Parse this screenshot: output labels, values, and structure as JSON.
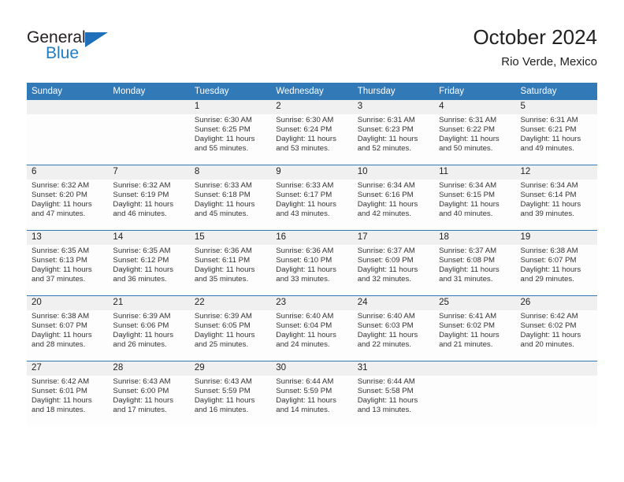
{
  "brand": {
    "name_part1": "General",
    "name_part2": "Blue",
    "accent_color": "#1f7dc4",
    "triangle_color": "#1f6fbb"
  },
  "header": {
    "title": "October 2024",
    "subtitle": "Rio Verde, Mexico"
  },
  "calendar": {
    "header_bg": "#3279b8",
    "header_text_color": "#ffffff",
    "daynum_bg": "#f0f0f0",
    "weekdays": [
      "Sunday",
      "Monday",
      "Tuesday",
      "Wednesday",
      "Thursday",
      "Friday",
      "Saturday"
    ],
    "weeks": [
      [
        {
          "day": "",
          "sunrise": "",
          "sunset": "",
          "daylight1": "",
          "daylight2": ""
        },
        {
          "day": "",
          "sunrise": "",
          "sunset": "",
          "daylight1": "",
          "daylight2": ""
        },
        {
          "day": "1",
          "sunrise": "Sunrise: 6:30 AM",
          "sunset": "Sunset: 6:25 PM",
          "daylight1": "Daylight: 11 hours",
          "daylight2": "and 55 minutes."
        },
        {
          "day": "2",
          "sunrise": "Sunrise: 6:30 AM",
          "sunset": "Sunset: 6:24 PM",
          "daylight1": "Daylight: 11 hours",
          "daylight2": "and 53 minutes."
        },
        {
          "day": "3",
          "sunrise": "Sunrise: 6:31 AM",
          "sunset": "Sunset: 6:23 PM",
          "daylight1": "Daylight: 11 hours",
          "daylight2": "and 52 minutes."
        },
        {
          "day": "4",
          "sunrise": "Sunrise: 6:31 AM",
          "sunset": "Sunset: 6:22 PM",
          "daylight1": "Daylight: 11 hours",
          "daylight2": "and 50 minutes."
        },
        {
          "day": "5",
          "sunrise": "Sunrise: 6:31 AM",
          "sunset": "Sunset: 6:21 PM",
          "daylight1": "Daylight: 11 hours",
          "daylight2": "and 49 minutes."
        }
      ],
      [
        {
          "day": "6",
          "sunrise": "Sunrise: 6:32 AM",
          "sunset": "Sunset: 6:20 PM",
          "daylight1": "Daylight: 11 hours",
          "daylight2": "and 47 minutes."
        },
        {
          "day": "7",
          "sunrise": "Sunrise: 6:32 AM",
          "sunset": "Sunset: 6:19 PM",
          "daylight1": "Daylight: 11 hours",
          "daylight2": "and 46 minutes."
        },
        {
          "day": "8",
          "sunrise": "Sunrise: 6:33 AM",
          "sunset": "Sunset: 6:18 PM",
          "daylight1": "Daylight: 11 hours",
          "daylight2": "and 45 minutes."
        },
        {
          "day": "9",
          "sunrise": "Sunrise: 6:33 AM",
          "sunset": "Sunset: 6:17 PM",
          "daylight1": "Daylight: 11 hours",
          "daylight2": "and 43 minutes."
        },
        {
          "day": "10",
          "sunrise": "Sunrise: 6:34 AM",
          "sunset": "Sunset: 6:16 PM",
          "daylight1": "Daylight: 11 hours",
          "daylight2": "and 42 minutes."
        },
        {
          "day": "11",
          "sunrise": "Sunrise: 6:34 AM",
          "sunset": "Sunset: 6:15 PM",
          "daylight1": "Daylight: 11 hours",
          "daylight2": "and 40 minutes."
        },
        {
          "day": "12",
          "sunrise": "Sunrise: 6:34 AM",
          "sunset": "Sunset: 6:14 PM",
          "daylight1": "Daylight: 11 hours",
          "daylight2": "and 39 minutes."
        }
      ],
      [
        {
          "day": "13",
          "sunrise": "Sunrise: 6:35 AM",
          "sunset": "Sunset: 6:13 PM",
          "daylight1": "Daylight: 11 hours",
          "daylight2": "and 37 minutes."
        },
        {
          "day": "14",
          "sunrise": "Sunrise: 6:35 AM",
          "sunset": "Sunset: 6:12 PM",
          "daylight1": "Daylight: 11 hours",
          "daylight2": "and 36 minutes."
        },
        {
          "day": "15",
          "sunrise": "Sunrise: 6:36 AM",
          "sunset": "Sunset: 6:11 PM",
          "daylight1": "Daylight: 11 hours",
          "daylight2": "and 35 minutes."
        },
        {
          "day": "16",
          "sunrise": "Sunrise: 6:36 AM",
          "sunset": "Sunset: 6:10 PM",
          "daylight1": "Daylight: 11 hours",
          "daylight2": "and 33 minutes."
        },
        {
          "day": "17",
          "sunrise": "Sunrise: 6:37 AM",
          "sunset": "Sunset: 6:09 PM",
          "daylight1": "Daylight: 11 hours",
          "daylight2": "and 32 minutes."
        },
        {
          "day": "18",
          "sunrise": "Sunrise: 6:37 AM",
          "sunset": "Sunset: 6:08 PM",
          "daylight1": "Daylight: 11 hours",
          "daylight2": "and 31 minutes."
        },
        {
          "day": "19",
          "sunrise": "Sunrise: 6:38 AM",
          "sunset": "Sunset: 6:07 PM",
          "daylight1": "Daylight: 11 hours",
          "daylight2": "and 29 minutes."
        }
      ],
      [
        {
          "day": "20",
          "sunrise": "Sunrise: 6:38 AM",
          "sunset": "Sunset: 6:07 PM",
          "daylight1": "Daylight: 11 hours",
          "daylight2": "and 28 minutes."
        },
        {
          "day": "21",
          "sunrise": "Sunrise: 6:39 AM",
          "sunset": "Sunset: 6:06 PM",
          "daylight1": "Daylight: 11 hours",
          "daylight2": "and 26 minutes."
        },
        {
          "day": "22",
          "sunrise": "Sunrise: 6:39 AM",
          "sunset": "Sunset: 6:05 PM",
          "daylight1": "Daylight: 11 hours",
          "daylight2": "and 25 minutes."
        },
        {
          "day": "23",
          "sunrise": "Sunrise: 6:40 AM",
          "sunset": "Sunset: 6:04 PM",
          "daylight1": "Daylight: 11 hours",
          "daylight2": "and 24 minutes."
        },
        {
          "day": "24",
          "sunrise": "Sunrise: 6:40 AM",
          "sunset": "Sunset: 6:03 PM",
          "daylight1": "Daylight: 11 hours",
          "daylight2": "and 22 minutes."
        },
        {
          "day": "25",
          "sunrise": "Sunrise: 6:41 AM",
          "sunset": "Sunset: 6:02 PM",
          "daylight1": "Daylight: 11 hours",
          "daylight2": "and 21 minutes."
        },
        {
          "day": "26",
          "sunrise": "Sunrise: 6:42 AM",
          "sunset": "Sunset: 6:02 PM",
          "daylight1": "Daylight: 11 hours",
          "daylight2": "and 20 minutes."
        }
      ],
      [
        {
          "day": "27",
          "sunrise": "Sunrise: 6:42 AM",
          "sunset": "Sunset: 6:01 PM",
          "daylight1": "Daylight: 11 hours",
          "daylight2": "and 18 minutes."
        },
        {
          "day": "28",
          "sunrise": "Sunrise: 6:43 AM",
          "sunset": "Sunset: 6:00 PM",
          "daylight1": "Daylight: 11 hours",
          "daylight2": "and 17 minutes."
        },
        {
          "day": "29",
          "sunrise": "Sunrise: 6:43 AM",
          "sunset": "Sunset: 5:59 PM",
          "daylight1": "Daylight: 11 hours",
          "daylight2": "and 16 minutes."
        },
        {
          "day": "30",
          "sunrise": "Sunrise: 6:44 AM",
          "sunset": "Sunset: 5:59 PM",
          "daylight1": "Daylight: 11 hours",
          "daylight2": "and 14 minutes."
        },
        {
          "day": "31",
          "sunrise": "Sunrise: 6:44 AM",
          "sunset": "Sunset: 5:58 PM",
          "daylight1": "Daylight: 11 hours",
          "daylight2": "and 13 minutes."
        },
        {
          "day": "",
          "sunrise": "",
          "sunset": "",
          "daylight1": "",
          "daylight2": ""
        },
        {
          "day": "",
          "sunrise": "",
          "sunset": "",
          "daylight1": "",
          "daylight2": ""
        }
      ]
    ]
  }
}
